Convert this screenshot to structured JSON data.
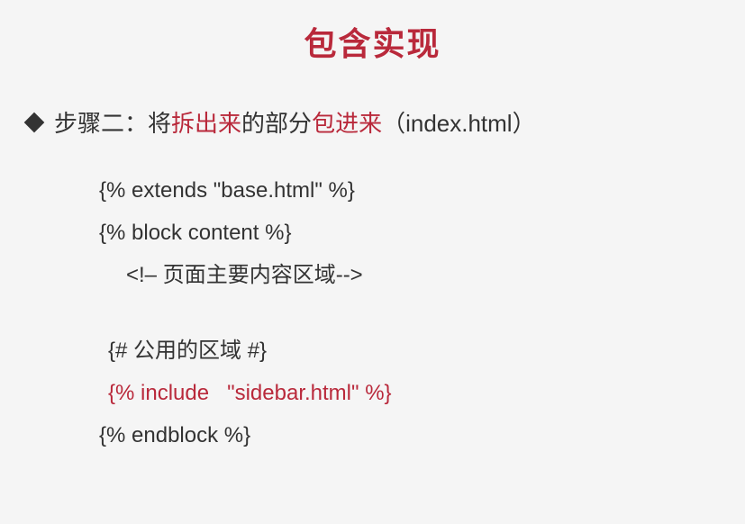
{
  "title": "包含实现",
  "step": {
    "label": "步骤二：",
    "prefix": "将",
    "highlight1": "拆出来",
    "mid": "的部分",
    "highlight2": "包进来",
    "suffix": "（index.html）"
  },
  "code": {
    "line1": "{% extends \"base.html\" %}",
    "line2": "{% block content %}",
    "line3": "<!– 页面主要内容区域-->",
    "line4": "{# 公用的区域 #}",
    "line5": "{% include   \"sidebar.html\" %}",
    "line6": "{% endblock %}"
  }
}
